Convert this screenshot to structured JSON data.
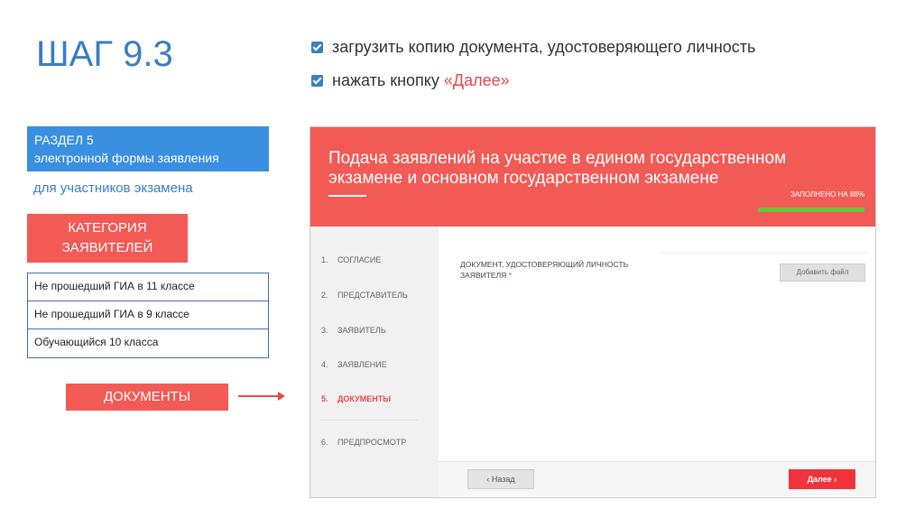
{
  "step_title": "ШАГ 9.3",
  "instructions": {
    "item1": "загрузить копию документа, удостоверяющего личность",
    "item2_prefix": "нажать кнопку ",
    "item2_highlight": "«Далее»"
  },
  "left_panel": {
    "section_line1": "РАЗДЕЛ 5",
    "section_line2": "электронной формы заявления",
    "section_sub": "для участников экзамена",
    "category_line1": "КАТЕГОРИЯ",
    "category_line2": "ЗАЯВИТЕЛЕЙ",
    "categories": [
      "Не прошедший ГИА в 11 классе",
      "Не прошедший ГИА в 9 классе",
      "Обучающийся 10 класса"
    ],
    "documents_label": "ДОКУМЕНТЫ"
  },
  "form": {
    "title": "Подача заявлений на участие в едином государственном экзамене и основном государственном экзамене",
    "progress_label": "ЗАПОЛНЕНО НА 88%",
    "progress_value": 88,
    "nav": [
      {
        "num": "1.",
        "label": "СОГЛАСИЕ"
      },
      {
        "num": "2.",
        "label": "ПРЕДСТАВИТЕЛЬ"
      },
      {
        "num": "3.",
        "label": "ЗАЯВИТЕЛЬ"
      },
      {
        "num": "4.",
        "label": "ЗАЯВЛЕНИЕ"
      },
      {
        "num": "5.",
        "label": "ДОКУМЕНТЫ"
      },
      {
        "num": "6.",
        "label": "ПРЕДПРОСМОТР"
      }
    ],
    "doc_label_line1": "ДОКУМЕНТ, УДОСТОВЕРЯЮЩИЙ ЛИЧНОСТЬ",
    "doc_label_line2": "ЗАЯВИТЕЛЯ",
    "required_mark": "*",
    "add_file_button": "Добавить файл",
    "back_button": "‹  Назад",
    "next_button": "Далее  ›"
  },
  "colors": {
    "accent_red": "#f25a55",
    "accent_blue": "#3a7ec3",
    "progress_green": "#6bc23a"
  }
}
